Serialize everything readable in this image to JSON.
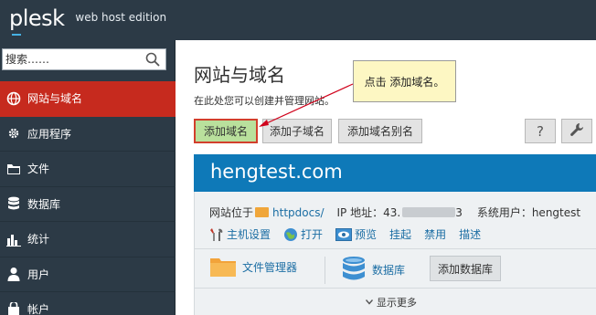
{
  "header": {
    "brand": "plesk",
    "edition": "web host edition"
  },
  "sidebar": {
    "search_placeholder": "搜索……",
    "items": [
      {
        "label": "网站与域名",
        "icon": "globe-icon",
        "active": true
      },
      {
        "label": "应用程序",
        "icon": "gear-icon",
        "active": false
      },
      {
        "label": "文件",
        "icon": "folder-icon",
        "active": false
      },
      {
        "label": "数据库",
        "icon": "database-icon",
        "active": false
      },
      {
        "label": "统计",
        "icon": "bar-chart-icon",
        "active": false
      },
      {
        "label": "用户",
        "icon": "user-icon",
        "active": false
      },
      {
        "label": "帐户",
        "icon": "account-icon",
        "active": false
      }
    ]
  },
  "main": {
    "title": "网站与域名",
    "description": "在此处您可以创建并管理网站。",
    "buttons": {
      "add_domain": "添加域名",
      "add_subdomain": "添加子域名",
      "add_alias": "添加域名别名"
    },
    "help_icon": "?",
    "callout": "点击 添加域名。",
    "domain": {
      "name": "hengtest.com",
      "location_label": "网站位于",
      "location_link": "httpdocs/",
      "ip_label": "IP 地址：43.",
      "ip_tail": "3",
      "user_label": "系统用户：hengtest",
      "actions": [
        {
          "label": "主机设置",
          "icon": "tools-icon"
        },
        {
          "label": "打开",
          "icon": "globe-icon"
        },
        {
          "label": "预览",
          "icon": "preview-icon"
        },
        {
          "label": "挂起",
          "icon": ""
        },
        {
          "label": "禁用",
          "icon": ""
        },
        {
          "label": "描述",
          "icon": ""
        }
      ],
      "file_manager": "文件管理器",
      "databases": "数据库",
      "add_database": "添加数据库",
      "show_more": "显示更多"
    }
  },
  "colors": {
    "active": "#c62a1e",
    "accent": "#0e79b8",
    "sidebar": "#2c3a46",
    "link": "#1c6ea4"
  }
}
